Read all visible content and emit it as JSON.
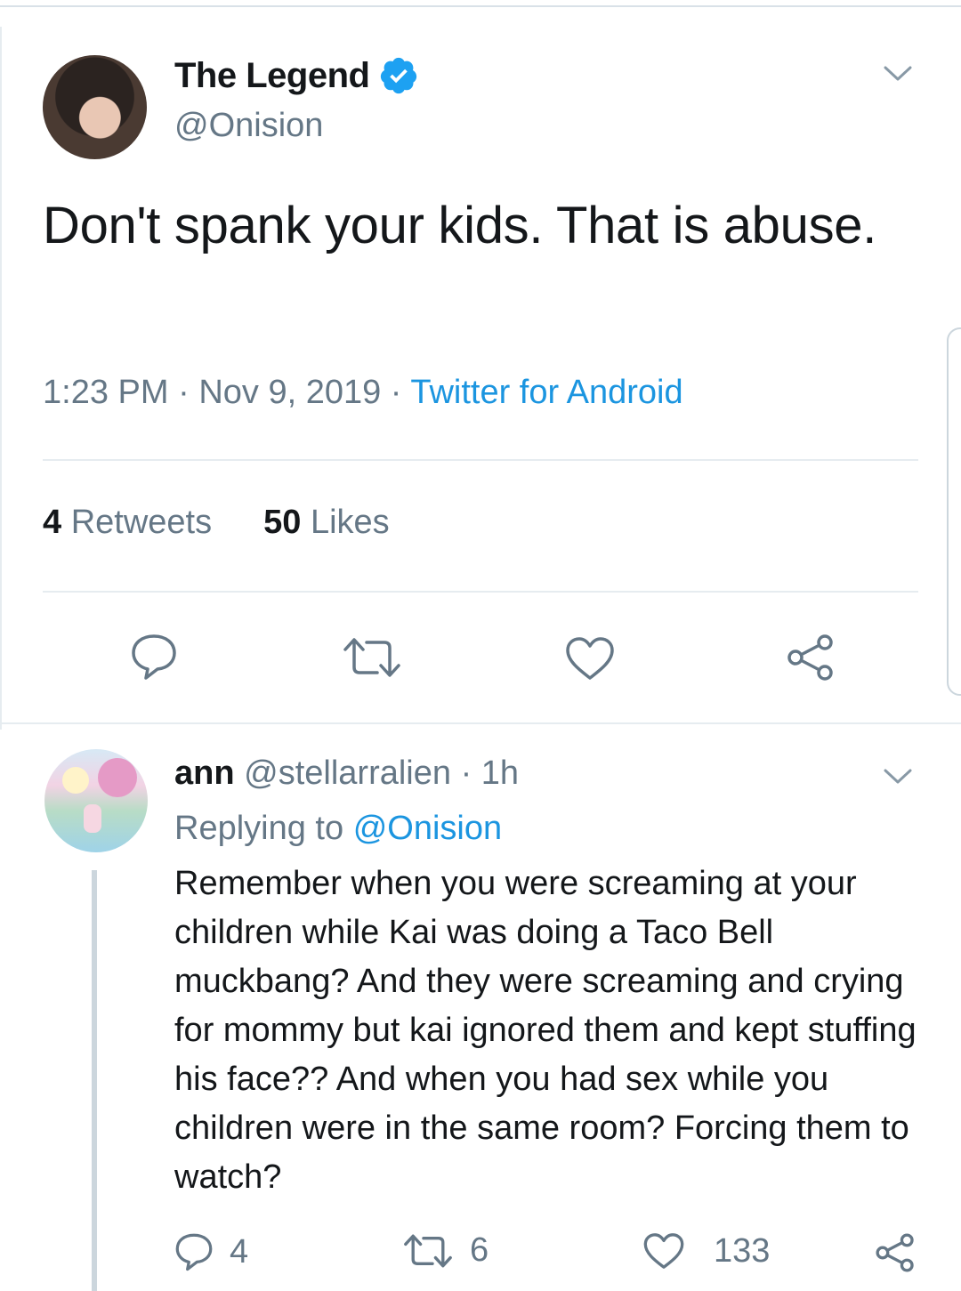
{
  "tweet": {
    "display_name": "The Legend",
    "handle": "@Onision",
    "text": "Don't spank your kids. That is abuse.",
    "time": "1:23 PM",
    "date": "Nov 9, 2019",
    "source": "Twitter for Android",
    "retweets_count": "4",
    "retweets_label": "Retweets",
    "likes_count": "50",
    "likes_label": "Likes",
    "icons": [
      "reply-icon",
      "retweet-icon",
      "like-icon",
      "share-icon",
      "verified-badge-icon",
      "chevron-down-icon"
    ]
  },
  "reply": {
    "display_name": "ann",
    "handle": "@stellarralien",
    "age": "1h",
    "replying_prefix": "Replying to",
    "replying_handle": "@Onision",
    "text": "Remember when you were screaming at your children while Kai was doing a Taco Bell muckbang? And they were screaming and crying for mommy but kai ignored them and kept stuffing his face?? And when you had sex while you children were in the same room? Forcing them to watch?",
    "reply_count": "4",
    "retweet_count": "6",
    "like_count": "133"
  },
  "colors": {
    "link": "#1b95e0",
    "secondary_text": "#657786",
    "primary_text": "#14171a",
    "divider": "#e6ecf0"
  }
}
